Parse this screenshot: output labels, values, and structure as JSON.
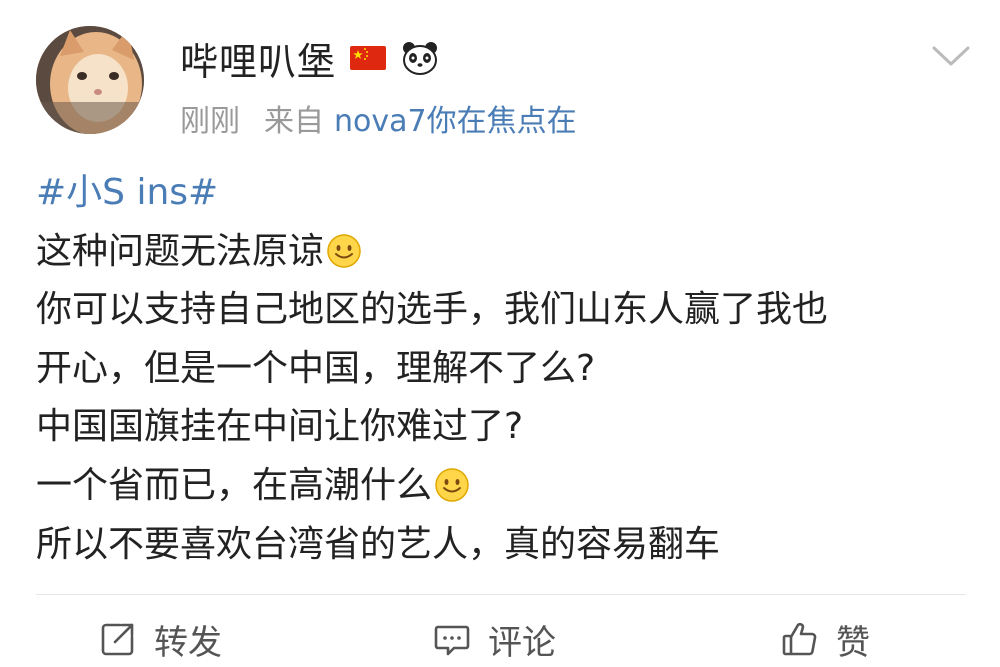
{
  "post": {
    "author": {
      "username": "哔哩叭堡",
      "badges": [
        "china-flag-icon",
        "panda-icon"
      ]
    },
    "meta": {
      "time": "刚刚",
      "from_label": "来自",
      "source": "nova7你在焦点在"
    },
    "content": {
      "hashtag": "#小S ins#",
      "lines": [
        "这种问题无法原谅",
        "你可以支持自己地区的选手，我们山东人赢了我也",
        "开心，但是一个中国，理解不了么?",
        "中国国旗挂在中间让你难过了?",
        "一个省而已，在高潮什么",
        "所以不要喜欢台湾省的艺人，真的容易翻车"
      ]
    },
    "actions": {
      "repost_label": "转发",
      "comment_label": "评论",
      "like_label": "赞"
    }
  },
  "colors": {
    "link": "#4a7cb5",
    "text": "#222222",
    "muted": "#999999",
    "divider": "#e6e6e6"
  }
}
